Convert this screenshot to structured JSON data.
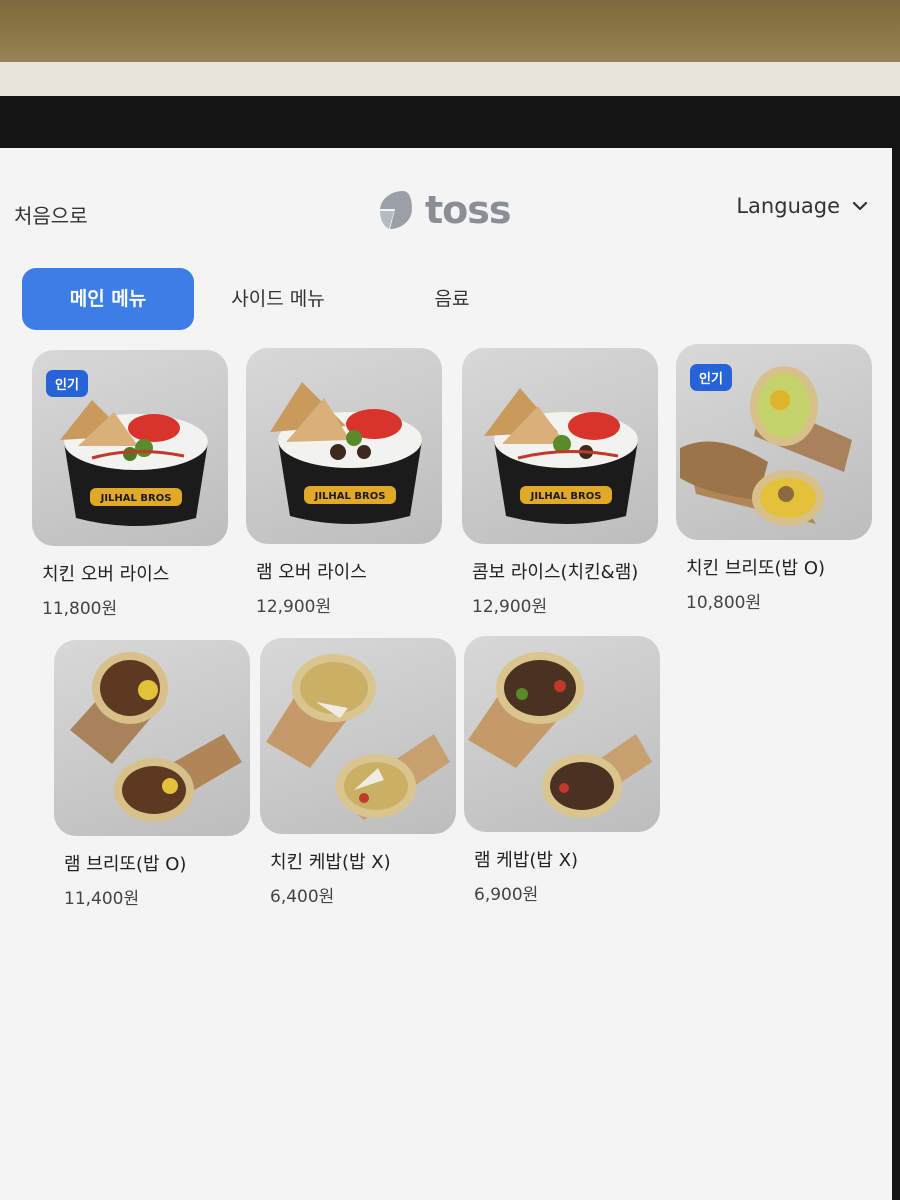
{
  "header": {
    "home_label": "처음으로",
    "logo_text": "toss",
    "language_label": "Language"
  },
  "tabs": [
    {
      "label": "메인 메뉴",
      "active": true
    },
    {
      "label": "사이드 메뉴",
      "active": false
    },
    {
      "label": "음료",
      "active": false
    }
  ],
  "menu": {
    "items": [
      {
        "name": "치킨 오버 라이스",
        "price": "11,800원",
        "badge": "인기",
        "image": "rice-bowl"
      },
      {
        "name": "램 오버 라이스",
        "price": "12,900원",
        "image": "rice-bowl"
      },
      {
        "name": "콤보 라이스(치킨&램)",
        "price": "12,900원",
        "image": "rice-bowl"
      },
      {
        "name": "치킨 브리또(밥 O)",
        "price": "10,800원",
        "badge": "인기",
        "image": "burrito"
      },
      {
        "name": "램 브리또(밥 O)",
        "price": "11,400원",
        "image": "burrito"
      },
      {
        "name": "치킨 케밥(밥 X)",
        "price": "6,400원",
        "image": "kebab-wrap"
      },
      {
        "name": "램 케밥(밥 X)",
        "price": "6,900원",
        "image": "kebab-wrap"
      }
    ],
    "bowl_label": "JILHAL BROS"
  },
  "colors": {
    "accent": "#3d7de6",
    "badge": "#2563d6"
  }
}
